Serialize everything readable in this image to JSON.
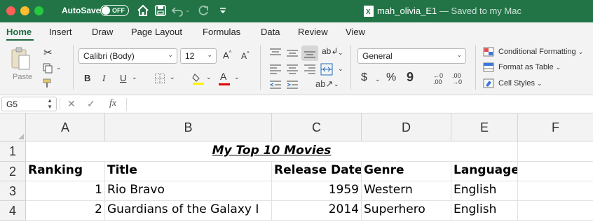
{
  "titlebar": {
    "autosave_label": "AutoSave",
    "autosave_state": "OFF",
    "doc_name": "mah_olivia_E1",
    "doc_status": "— Saved to my Mac"
  },
  "ribbon_tabs": [
    "Home",
    "Insert",
    "Draw",
    "Page Layout",
    "Formulas",
    "Data",
    "Review",
    "View"
  ],
  "ribbon": {
    "paste_label": "Paste",
    "font_name": "Calibri (Body)",
    "font_size": "12",
    "grow_font": "A^",
    "shrink_font": "A^",
    "bold": "B",
    "italic": "I",
    "underline": "U",
    "number_format": "General",
    "currency": "$",
    "percent": "%",
    "comma": "9",
    "increase_decimal": ".00",
    "decrease_decimal": ".00",
    "conditional_formatting": "Conditional Formatting",
    "format_as_table": "Format as Table",
    "cell_styles": "Cell Styles"
  },
  "formula_bar": {
    "name_box": "G5",
    "fx": "fx",
    "content": ""
  },
  "columns": [
    "A",
    "B",
    "C",
    "D",
    "E",
    "F"
  ],
  "rows": [
    "1",
    "2",
    "3",
    "4"
  ],
  "sheet": {
    "title": "My Top 10 Movies",
    "headers": [
      "Ranking",
      "Title",
      "Release Date",
      "Genre",
      "Language"
    ],
    "data": [
      [
        "1",
        "Rio Bravo",
        "1959",
        "Western",
        "English"
      ],
      [
        "2",
        "Guardians of the Galaxy I",
        "2014",
        "Superhero",
        "English"
      ]
    ]
  },
  "colors": {
    "titlebar": "#227447",
    "accent": "#1d6b3f"
  }
}
